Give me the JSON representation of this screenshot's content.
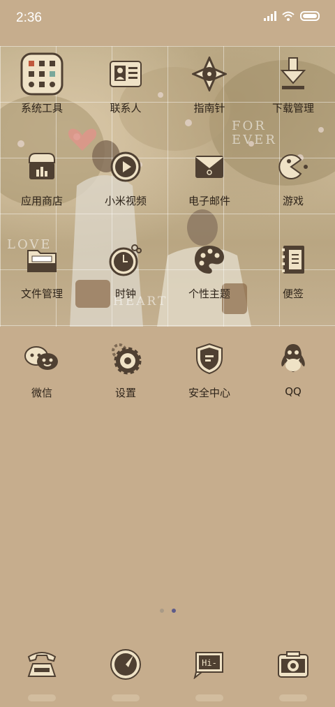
{
  "status_bar": {
    "time": "2:36"
  },
  "wallpaper": {
    "words": [
      "FOR",
      "EVER",
      "LOVE",
      "HEART"
    ]
  },
  "apps": [
    {
      "label": "系统工具",
      "icon": "system-tools-icon"
    },
    {
      "label": "联系人",
      "icon": "contacts-icon"
    },
    {
      "label": "指南针",
      "icon": "compass-icon"
    },
    {
      "label": "下载管理",
      "icon": "download-icon"
    },
    {
      "label": "应用商店",
      "icon": "app-store-icon"
    },
    {
      "label": "小米视频",
      "icon": "video-icon"
    },
    {
      "label": "电子邮件",
      "icon": "email-icon"
    },
    {
      "label": "游戏",
      "icon": "game-icon"
    },
    {
      "label": "文件管理",
      "icon": "file-manager-icon"
    },
    {
      "label": "时钟",
      "icon": "clock-icon"
    },
    {
      "label": "个性主题",
      "icon": "theme-icon"
    },
    {
      "label": "便签",
      "icon": "notes-icon"
    }
  ],
  "row2": [
    {
      "label": "微信",
      "icon": "wechat-icon"
    },
    {
      "label": "设置",
      "icon": "settings-icon"
    },
    {
      "label": "安全中心",
      "icon": "security-icon"
    },
    {
      "label": "QQ",
      "icon": "qq-icon"
    }
  ],
  "dock": [
    {
      "icon": "phone-icon"
    },
    {
      "icon": "browser-icon"
    },
    {
      "icon": "messages-icon",
      "text": "Hi-"
    },
    {
      "icon": "camera-icon"
    }
  ],
  "pages": {
    "count": 2,
    "active": 2
  },
  "colors": {
    "background": "#c6ad8d",
    "icon_dark": "#4f4032",
    "icon_light": "#efe2c6"
  }
}
